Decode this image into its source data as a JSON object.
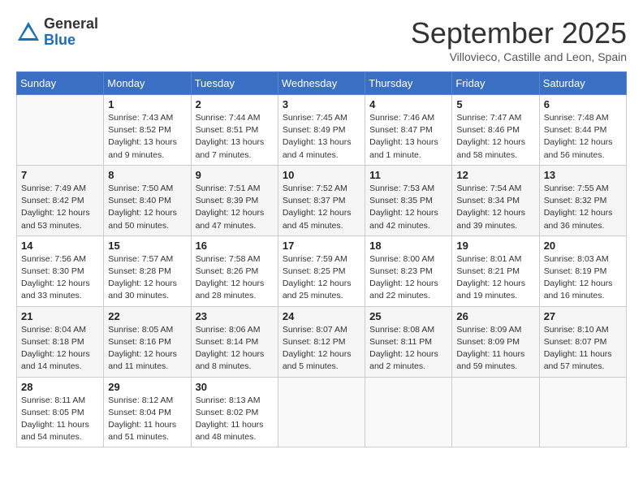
{
  "header": {
    "logo_general": "General",
    "logo_blue": "Blue",
    "month_title": "September 2025",
    "location": "Villovieco, Castille and Leon, Spain"
  },
  "days_of_week": [
    "Sunday",
    "Monday",
    "Tuesday",
    "Wednesday",
    "Thursday",
    "Friday",
    "Saturday"
  ],
  "weeks": [
    [
      {
        "num": "",
        "info": ""
      },
      {
        "num": "1",
        "info": "Sunrise: 7:43 AM\nSunset: 8:52 PM\nDaylight: 13 hours\nand 9 minutes."
      },
      {
        "num": "2",
        "info": "Sunrise: 7:44 AM\nSunset: 8:51 PM\nDaylight: 13 hours\nand 7 minutes."
      },
      {
        "num": "3",
        "info": "Sunrise: 7:45 AM\nSunset: 8:49 PM\nDaylight: 13 hours\nand 4 minutes."
      },
      {
        "num": "4",
        "info": "Sunrise: 7:46 AM\nSunset: 8:47 PM\nDaylight: 13 hours\nand 1 minute."
      },
      {
        "num": "5",
        "info": "Sunrise: 7:47 AM\nSunset: 8:46 PM\nDaylight: 12 hours\nand 58 minutes."
      },
      {
        "num": "6",
        "info": "Sunrise: 7:48 AM\nSunset: 8:44 PM\nDaylight: 12 hours\nand 56 minutes."
      }
    ],
    [
      {
        "num": "7",
        "info": "Sunrise: 7:49 AM\nSunset: 8:42 PM\nDaylight: 12 hours\nand 53 minutes."
      },
      {
        "num": "8",
        "info": "Sunrise: 7:50 AM\nSunset: 8:40 PM\nDaylight: 12 hours\nand 50 minutes."
      },
      {
        "num": "9",
        "info": "Sunrise: 7:51 AM\nSunset: 8:39 PM\nDaylight: 12 hours\nand 47 minutes."
      },
      {
        "num": "10",
        "info": "Sunrise: 7:52 AM\nSunset: 8:37 PM\nDaylight: 12 hours\nand 45 minutes."
      },
      {
        "num": "11",
        "info": "Sunrise: 7:53 AM\nSunset: 8:35 PM\nDaylight: 12 hours\nand 42 minutes."
      },
      {
        "num": "12",
        "info": "Sunrise: 7:54 AM\nSunset: 8:34 PM\nDaylight: 12 hours\nand 39 minutes."
      },
      {
        "num": "13",
        "info": "Sunrise: 7:55 AM\nSunset: 8:32 PM\nDaylight: 12 hours\nand 36 minutes."
      }
    ],
    [
      {
        "num": "14",
        "info": "Sunrise: 7:56 AM\nSunset: 8:30 PM\nDaylight: 12 hours\nand 33 minutes."
      },
      {
        "num": "15",
        "info": "Sunrise: 7:57 AM\nSunset: 8:28 PM\nDaylight: 12 hours\nand 30 minutes."
      },
      {
        "num": "16",
        "info": "Sunrise: 7:58 AM\nSunset: 8:26 PM\nDaylight: 12 hours\nand 28 minutes."
      },
      {
        "num": "17",
        "info": "Sunrise: 7:59 AM\nSunset: 8:25 PM\nDaylight: 12 hours\nand 25 minutes."
      },
      {
        "num": "18",
        "info": "Sunrise: 8:00 AM\nSunset: 8:23 PM\nDaylight: 12 hours\nand 22 minutes."
      },
      {
        "num": "19",
        "info": "Sunrise: 8:01 AM\nSunset: 8:21 PM\nDaylight: 12 hours\nand 19 minutes."
      },
      {
        "num": "20",
        "info": "Sunrise: 8:03 AM\nSunset: 8:19 PM\nDaylight: 12 hours\nand 16 minutes."
      }
    ],
    [
      {
        "num": "21",
        "info": "Sunrise: 8:04 AM\nSunset: 8:18 PM\nDaylight: 12 hours\nand 14 minutes."
      },
      {
        "num": "22",
        "info": "Sunrise: 8:05 AM\nSunset: 8:16 PM\nDaylight: 12 hours\nand 11 minutes."
      },
      {
        "num": "23",
        "info": "Sunrise: 8:06 AM\nSunset: 8:14 PM\nDaylight: 12 hours\nand 8 minutes."
      },
      {
        "num": "24",
        "info": "Sunrise: 8:07 AM\nSunset: 8:12 PM\nDaylight: 12 hours\nand 5 minutes."
      },
      {
        "num": "25",
        "info": "Sunrise: 8:08 AM\nSunset: 8:11 PM\nDaylight: 12 hours\nand 2 minutes."
      },
      {
        "num": "26",
        "info": "Sunrise: 8:09 AM\nSunset: 8:09 PM\nDaylight: 11 hours\nand 59 minutes."
      },
      {
        "num": "27",
        "info": "Sunrise: 8:10 AM\nSunset: 8:07 PM\nDaylight: 11 hours\nand 57 minutes."
      }
    ],
    [
      {
        "num": "28",
        "info": "Sunrise: 8:11 AM\nSunset: 8:05 PM\nDaylight: 11 hours\nand 54 minutes."
      },
      {
        "num": "29",
        "info": "Sunrise: 8:12 AM\nSunset: 8:04 PM\nDaylight: 11 hours\nand 51 minutes."
      },
      {
        "num": "30",
        "info": "Sunrise: 8:13 AM\nSunset: 8:02 PM\nDaylight: 11 hours\nand 48 minutes."
      },
      {
        "num": "",
        "info": ""
      },
      {
        "num": "",
        "info": ""
      },
      {
        "num": "",
        "info": ""
      },
      {
        "num": "",
        "info": ""
      }
    ]
  ]
}
